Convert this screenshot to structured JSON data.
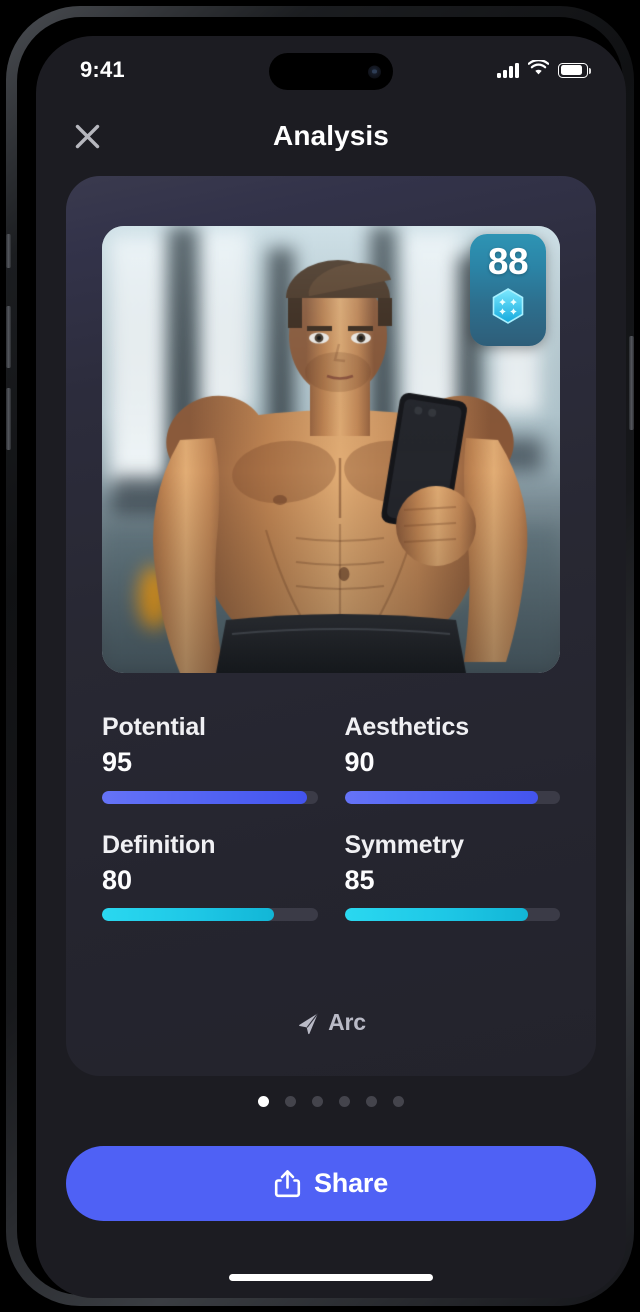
{
  "status_bar": {
    "time": "9:41",
    "cellular_icon": "signal-bars-icon",
    "wifi_icon": "wifi-icon",
    "battery_icon": "battery-icon"
  },
  "nav": {
    "close_icon": "close-icon",
    "title": "Analysis"
  },
  "card": {
    "photo_alt": "gym-mirror-selfie-photo",
    "score_badge": {
      "value": "88",
      "gem_icon": "gem-hexagon-icon"
    },
    "metrics": [
      {
        "label": "Potential",
        "value": "95",
        "percent": 95,
        "color": "#5263f3",
        "style": "fill-indigo"
      },
      {
        "label": "Aesthetics",
        "value": "90",
        "percent": 90,
        "color": "#5263f3",
        "style": "fill-indigo"
      },
      {
        "label": "Definition",
        "value": "80",
        "percent": 80,
        "color": "#1ec7e6",
        "style": "fill-cyan"
      },
      {
        "label": "Symmetry",
        "value": "85",
        "percent": 85,
        "color": "#1ec7e6",
        "style": "fill-cyan"
      }
    ],
    "brand": {
      "logo_icon": "arc-arrow-logo-icon",
      "name": "Arc"
    }
  },
  "pagination": {
    "total": 6,
    "active_index": 0
  },
  "share_button": {
    "label": "Share",
    "icon": "share-upload-icon",
    "color": "#4f61f5"
  },
  "home_indicator": "home-indicator-bar",
  "colors": {
    "screen_bg": "#1c1c22",
    "card_top": "#3a3a4e",
    "card_bottom": "#23232c",
    "track": "#3b3b47",
    "accent_indigo": "#4f61f5",
    "accent_cyan": "#1ec7e6",
    "badge_top": "#2e94b4",
    "badge_bottom": "#2e5e79"
  }
}
